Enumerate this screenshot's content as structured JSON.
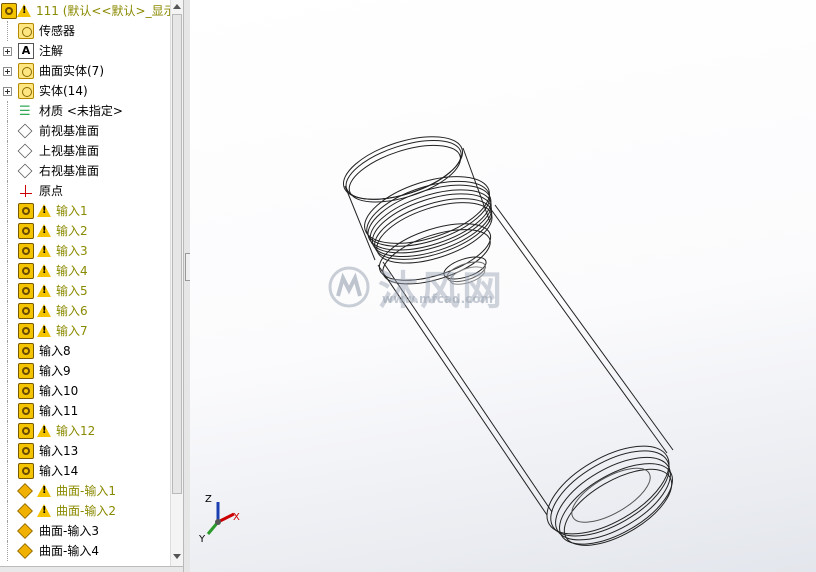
{
  "feature_tree": {
    "root": {
      "label": "111  (默认<<默认>_显示"
    },
    "items": [
      {
        "label": "传感器",
        "icon": "sensor-folder-icon",
        "warning": false,
        "expandable": false
      },
      {
        "label": "注解",
        "icon": "annotation-icon",
        "warning": false,
        "expandable": true
      },
      {
        "label": "曲面实体(7)",
        "icon": "surface-bodies-folder-icon",
        "warning": false,
        "expandable": true
      },
      {
        "label": "实体(14)",
        "icon": "solid-bodies-folder-icon",
        "warning": false,
        "expandable": true
      },
      {
        "label": "材质 <未指定>",
        "icon": "material-icon",
        "warning": false,
        "expandable": false
      },
      {
        "label": "前视基准面",
        "icon": "plane-icon",
        "warning": false,
        "expandable": false
      },
      {
        "label": "上视基准面",
        "icon": "plane-icon",
        "warning": false,
        "expandable": false
      },
      {
        "label": "右视基准面",
        "icon": "plane-icon",
        "warning": false,
        "expandable": false
      },
      {
        "label": "原点",
        "icon": "origin-icon",
        "warning": false,
        "expandable": false
      },
      {
        "label": "输入1",
        "icon": "imported-part-icon",
        "warning": true,
        "expandable": false
      },
      {
        "label": "输入2",
        "icon": "imported-part-icon",
        "warning": true,
        "expandable": false
      },
      {
        "label": "输入3",
        "icon": "imported-part-icon",
        "warning": true,
        "expandable": false
      },
      {
        "label": "输入4",
        "icon": "imported-part-icon",
        "warning": true,
        "expandable": false
      },
      {
        "label": "输入5",
        "icon": "imported-part-icon",
        "warning": true,
        "expandable": false
      },
      {
        "label": "输入6",
        "icon": "imported-part-icon",
        "warning": true,
        "expandable": false
      },
      {
        "label": "输入7",
        "icon": "imported-part-icon",
        "warning": true,
        "expandable": false
      },
      {
        "label": "输入8",
        "icon": "imported-part-icon",
        "warning": false,
        "expandable": false
      },
      {
        "label": "输入9",
        "icon": "imported-part-icon",
        "warning": false,
        "expandable": false
      },
      {
        "label": "输入10",
        "icon": "imported-part-icon",
        "warning": false,
        "expandable": false
      },
      {
        "label": "输入11",
        "icon": "imported-part-icon",
        "warning": false,
        "expandable": false
      },
      {
        "label": "输入12",
        "icon": "imported-part-icon",
        "warning": true,
        "expandable": false
      },
      {
        "label": "输入13",
        "icon": "imported-part-icon",
        "warning": false,
        "expandable": false
      },
      {
        "label": "输入14",
        "icon": "imported-part-icon",
        "warning": false,
        "expandable": false
      },
      {
        "label": "曲面-输入1",
        "icon": "surface-feature-icon",
        "warning": true,
        "expandable": false
      },
      {
        "label": "曲面-输入2",
        "icon": "surface-feature-icon",
        "warning": true,
        "expandable": false
      },
      {
        "label": "曲面-输入3",
        "icon": "surface-feature-icon",
        "warning": false,
        "expandable": false
      },
      {
        "label": "曲面-输入4",
        "icon": "surface-feature-icon",
        "warning": false,
        "expandable": false
      }
    ]
  },
  "viewport": {
    "watermark": "沐风网",
    "watermark_url": "www.mfcad.com",
    "triad": {
      "x": "X",
      "y": "Y",
      "z": "Z"
    }
  },
  "colors": {
    "warning_text": "#8a8a00",
    "triad_x": "#cc0000",
    "triad_y": "#2a9a2a",
    "triad_z": "#1a3fb0"
  }
}
